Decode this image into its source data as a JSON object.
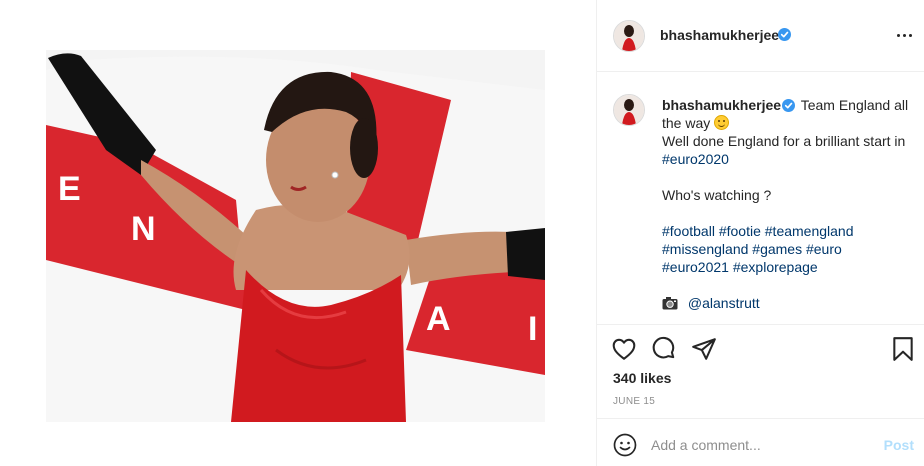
{
  "post": {
    "image_alt": "Woman in red satin dress and black gloves holding an England flag",
    "author": {
      "username": "bhashamukherjee",
      "verified": true,
      "avatar_icon": "profile-avatar"
    },
    "menu_icon": "more-options-icon",
    "caption": {
      "first_line": "Team England all the way",
      "line2": "Well done England for a brilliant start in",
      "line2_tag": "#euro2020",
      "question": "Who's watching ?",
      "hashtags_line1": [
        "#football",
        "#footie",
        "#teamengland"
      ],
      "hashtags_line2": [
        "#missengland",
        "#games",
        "#euro"
      ],
      "hashtags_line3": [
        "#euro2021",
        "#explorepage"
      ],
      "credit_icon": "camera-icon",
      "credit": "@alanstrutt"
    },
    "actions": {
      "like_icon": "heart-icon",
      "comment_icon": "comment-icon",
      "share_icon": "share-icon",
      "save_icon": "bookmark-icon"
    },
    "likes": "340 likes",
    "date": "JUNE 15",
    "comment": {
      "emoji_icon": "smiley-icon",
      "placeholder": "Add a comment...",
      "post_label": "Post"
    }
  },
  "colors": {
    "verified_blue": "#3897f0",
    "hashtag": "#00376b",
    "post_disabled": "#b2dffc",
    "flag_red": "#d9262e",
    "dress_red": "#d11a1f"
  }
}
